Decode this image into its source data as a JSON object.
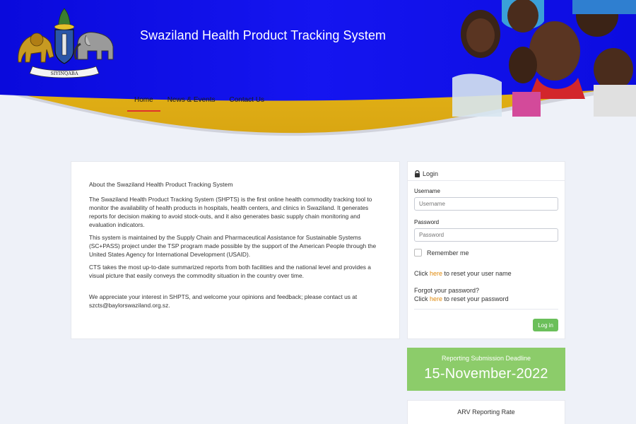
{
  "header": {
    "site_title": "Swaziland Health Product Tracking System",
    "crest_motto": "SIYINQABA",
    "colors": {
      "banner_blue": "#1010e8",
      "wave_gold": "#e3b418",
      "nav_active": "#e0322b"
    }
  },
  "nav": {
    "items": [
      {
        "label": "Home",
        "active": true
      },
      {
        "label": "News & Events",
        "active": false
      },
      {
        "label": "Contact Us",
        "active": false
      }
    ]
  },
  "about": {
    "heading": "About the Swaziland Health Product Tracking System",
    "p1": "The Swaziland Health Product Tracking System (SHPTS) is the first online health commodity tracking tool to monitor the availability of health products in hospitals, health centers, and clinics in Swaziland. It generates reports for decision making to avoid stock-outs, and it also generates basic supply chain monitoring and evaluation indicators.",
    "p2": "This system is maintained by the Supply Chain and Pharmaceutical Assistance for Sustainable Systems (SC+PASS) project under the TSP program made possible by the support of the American People through the United States Agency for International Development (USAID).",
    "p3": "CTS takes the most up-to-date summarized reports from both facilities and the national level and provides a visual picture that easily conveys the commodity situation in the country over time.",
    "p4": "We appreciate your interest in SHPTS, and welcome your opinions and feedback; please contact us at szcts@baylorswaziland.org.sz."
  },
  "login": {
    "title": "Login",
    "username_label": "Username",
    "username_placeholder": "Username",
    "password_label": "Password",
    "password_placeholder": "Password",
    "remember_label": "Remember me",
    "reset_user_pre": "Click",
    "reset_user_link": "here",
    "reset_user_post": "to reset your user name",
    "forgot_line": "Forgot your password?",
    "reset_pass_pre": "Click",
    "reset_pass_link": "here",
    "reset_pass_post": "to reset your password",
    "button": "Log in"
  },
  "deadline": {
    "label": "Reporting Submission Deadline",
    "date": "15-November-2022"
  },
  "arv": {
    "title": "ARV Reporting Rate"
  }
}
